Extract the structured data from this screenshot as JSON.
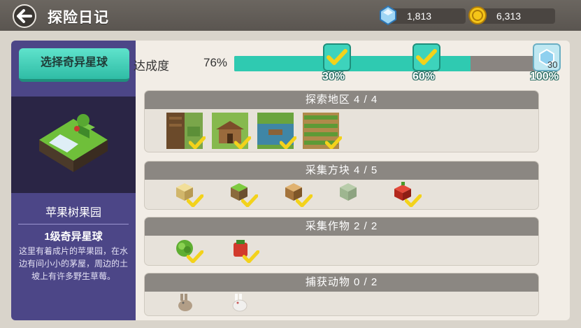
{
  "header": {
    "title": "探险日记",
    "diamonds": "1,813",
    "coins": "6,313"
  },
  "left_panel": {
    "select_button": "选择奇异星球",
    "planet_name": "苹果树果园",
    "planet_level": "1级奇异星球",
    "planet_description": "这里有着成片的苹果园，在水边有间小小的茅屋，周边的土坡上有许多野生草莓。"
  },
  "progress": {
    "label": "达成度",
    "value_text": "76%",
    "value": 0.76,
    "milestones": [
      {
        "label": "30%",
        "achieved": true
      },
      {
        "label": "60%",
        "achieved": true
      },
      {
        "label": "100%",
        "achieved": false,
        "reward_count": "30"
      }
    ]
  },
  "sections": [
    {
      "title": "探索地区 4 / 4",
      "items": [
        "field-area",
        "hut-area",
        "lake-area",
        "farm-area"
      ]
    },
    {
      "title": "采集方块 4 / 5",
      "items": [
        "sand-block",
        "grass-block",
        "wood-block",
        "moss-block",
        "apple-block"
      ]
    },
    {
      "title": "采集作物 2 / 2",
      "items": [
        "cabbage-crop",
        "strawberry-crop"
      ]
    },
    {
      "title": "捕获动物 0 / 2",
      "items": [
        "brown-rabbit",
        "white-rabbit"
      ]
    }
  ],
  "colors": {
    "accent": "#2fcab1",
    "panel_purple": "#4c4687",
    "section_header": "#8b8782"
  }
}
